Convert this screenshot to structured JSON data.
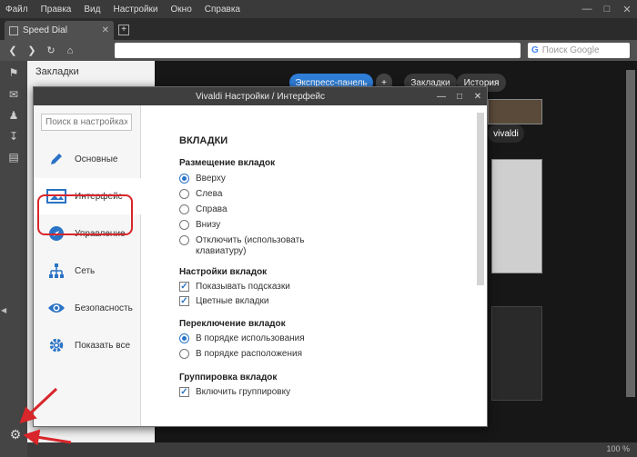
{
  "browser": {
    "menu": [
      "Файл",
      "Правка",
      "Вид",
      "Настройки",
      "Окно",
      "Справка"
    ],
    "tab_title": "Speed Dial",
    "search_placeholder": "Поиск Google",
    "zoom": "100 %"
  },
  "panel": {
    "title": "Закладки"
  },
  "speed_dial": {
    "pills": [
      "Экспресс-панель",
      "Закладки",
      "История"
    ],
    "tile_label": "vivaldi"
  },
  "dialog": {
    "title": "Vivaldi Настройки / Интерфейс",
    "search_placeholder": "Поиск в настройках",
    "nav": [
      "Основные",
      "Интерфейс",
      "Управление",
      "Сеть",
      "Безопасность",
      "Показать все"
    ],
    "section": "ВКЛАДКИ",
    "groups": [
      {
        "title": "Размещение вкладок",
        "options": [
          "Вверху",
          "Слева",
          "Справа",
          "Внизу",
          "Отключить (использовать клавиатуру)"
        ]
      },
      {
        "title": "Настройки вкладок",
        "options": [
          "Показывать подсказки",
          "Цветные вкладки"
        ]
      },
      {
        "title": "Переключение вкладок",
        "options": [
          "В порядке использования",
          "В порядке расположения"
        ]
      },
      {
        "title": "Группировка вкладок",
        "options": [
          "Включить группировку"
        ]
      }
    ]
  },
  "colors": {
    "accent": "#2a73c5",
    "highlight": "#d8262b",
    "pill_blue": "#2f7ed8"
  }
}
